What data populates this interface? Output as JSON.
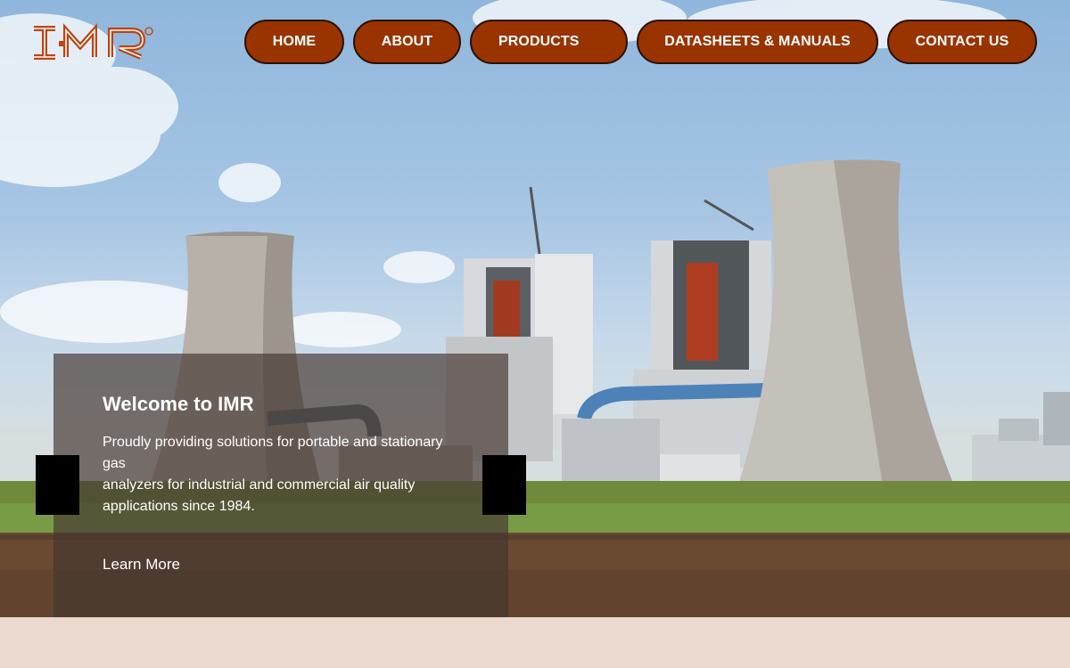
{
  "brand": {
    "logo_text": "IMR",
    "registered_mark": "®",
    "color": "#c0420c"
  },
  "nav": {
    "items": [
      {
        "label": "HOME"
      },
      {
        "label": "ABOUT"
      },
      {
        "label": "PRODUCTS"
      },
      {
        "label": "DATASHEETS & MANUALS"
      },
      {
        "label": "CONTACT US"
      }
    ],
    "button_color": "#993300"
  },
  "hero": {
    "title": "Welcome to IMR",
    "text_lines": [
      "Proudly providing solutions for portable and stationary gas",
      "analyzers for industrial and commercial air quality applications since 1984."
    ],
    "cta_label": "Learn More"
  },
  "slider": {
    "prev_icon": "slider-prev-icon",
    "next_icon": "slider-next-icon"
  }
}
